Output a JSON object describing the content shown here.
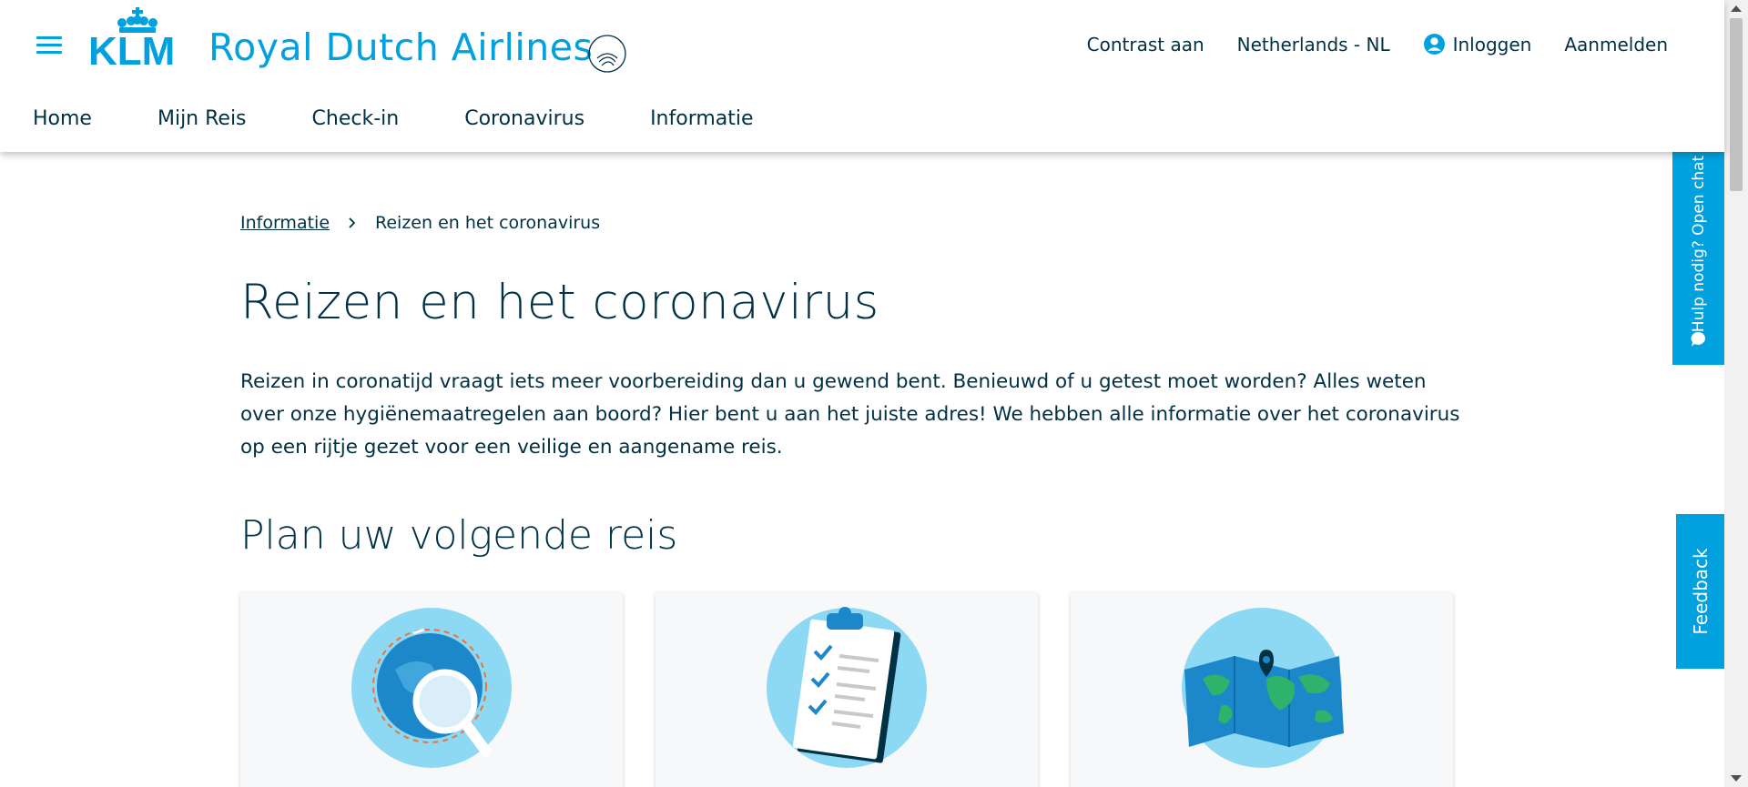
{
  "header": {
    "brand_short": "KLM",
    "brand_name": "Royal Dutch Airlines",
    "alliance_logo": "SKYTEAM",
    "links": {
      "contrast": "Contrast aan",
      "country": "Netherlands - NL",
      "login": "Inloggen",
      "signup": "Aanmelden"
    },
    "nav": [
      "Home",
      "Mijn Reis",
      "Check-in",
      "Coronavirus",
      "Informatie"
    ]
  },
  "breadcrumb": {
    "parent": "Informatie",
    "current": "Reizen en het coronavirus"
  },
  "page": {
    "title": "Reizen en het coronavirus",
    "intro": "Reizen in coronatijd vraagt iets meer voorbereiding dan u gewend bent. Benieuwd of u getest moet worden? Alles weten over onze hygiënemaatregelen aan boord? Hier bent u aan het juiste adres! We hebben alle informatie over het coronavirus op een rijtje gezet voor een veilige en aangename reis.",
    "section_title": "Plan uw volgende reis",
    "cards": [
      {
        "icon": "globe-magnifier-icon"
      },
      {
        "icon": "clipboard-checklist-icon"
      },
      {
        "icon": "world-map-icon"
      }
    ]
  },
  "side_tabs": {
    "chat": "Hulp nodig? Open chat",
    "feedback": "Feedback"
  },
  "colors": {
    "brand_blue": "#00a1de",
    "text_dark": "#003145",
    "light_blue": "#8dd8f3"
  }
}
